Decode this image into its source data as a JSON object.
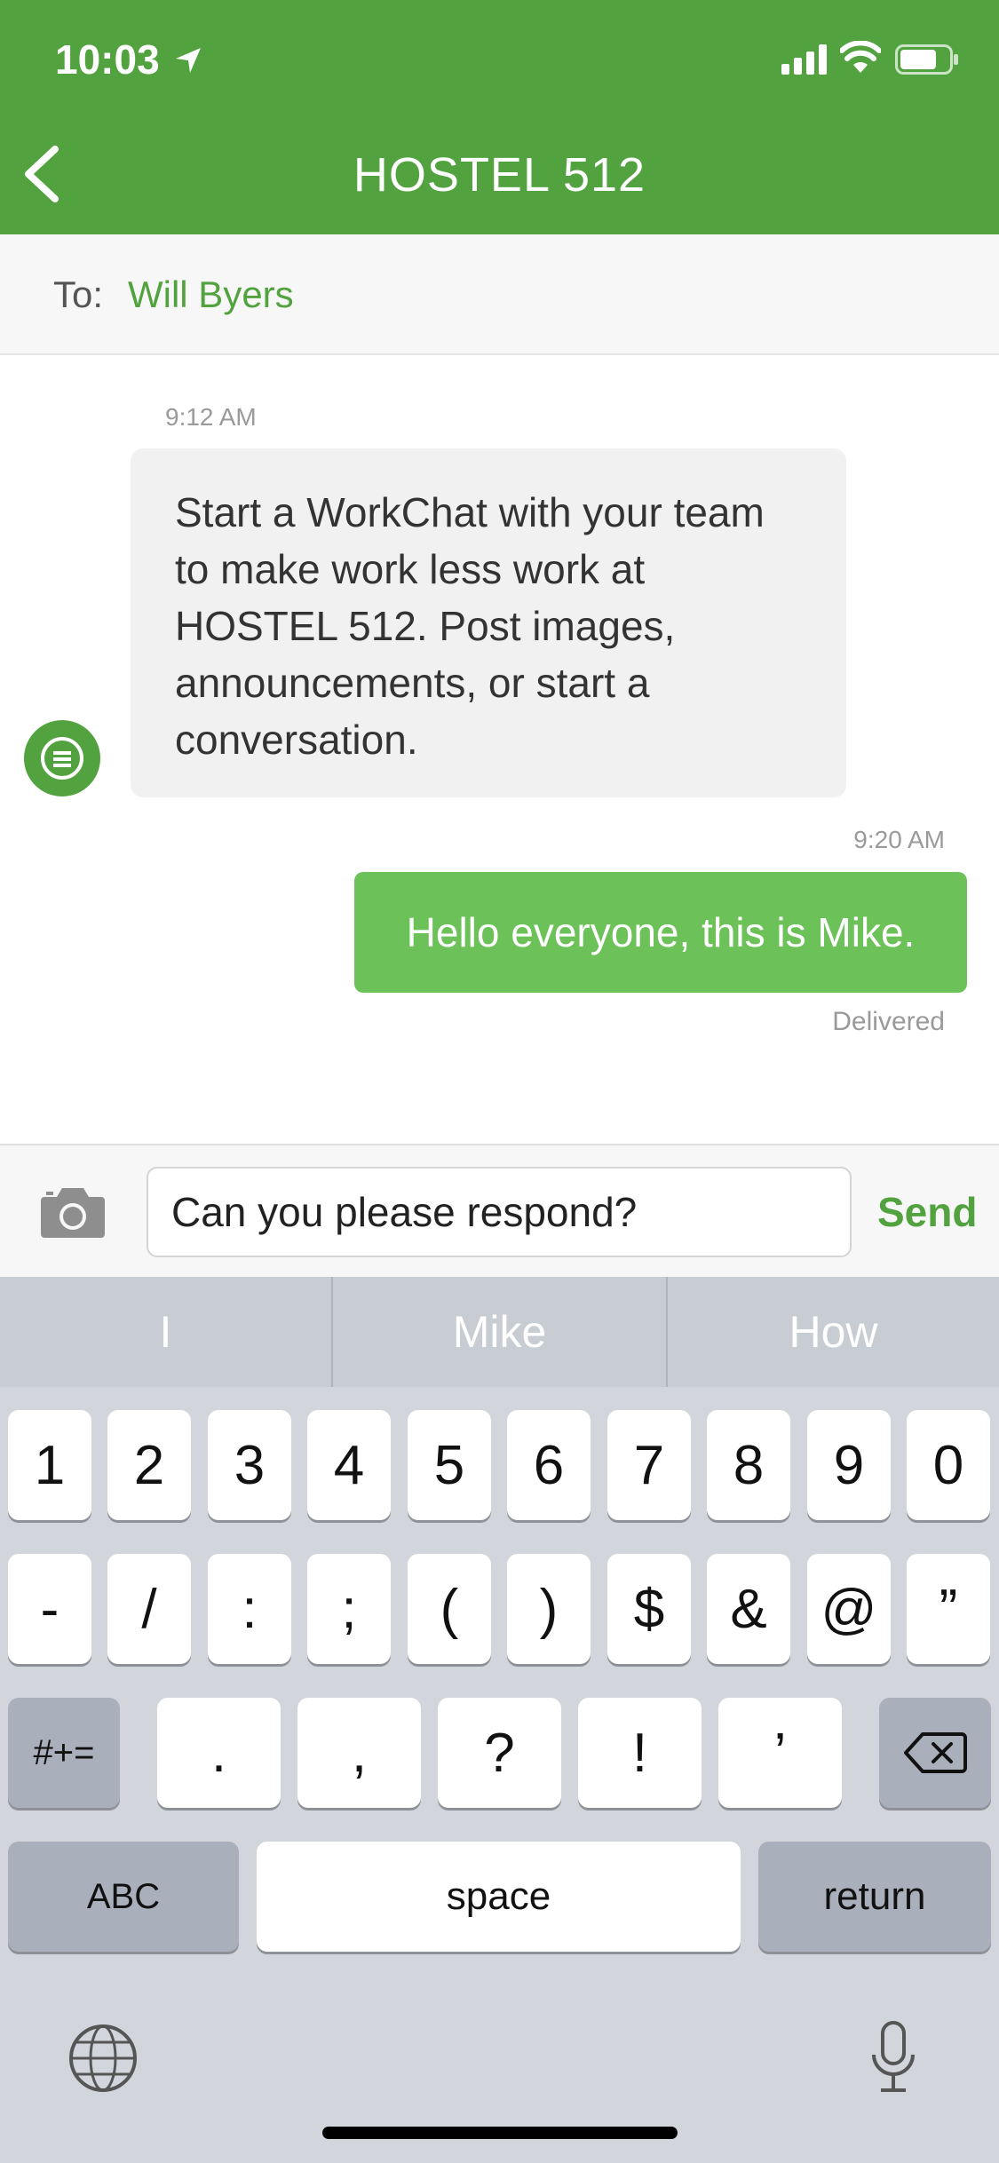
{
  "status_bar": {
    "time": "10:03",
    "icons": [
      "location-arrow-icon",
      "cellular-signal-icon",
      "wifi-icon",
      "battery-icon"
    ]
  },
  "header": {
    "title": "HOSTEL 512",
    "back_icon": "chevron-left-icon",
    "background": "#52a33f"
  },
  "recipient": {
    "label": "To:",
    "name": "Will Byers"
  },
  "messages": [
    {
      "timestamp": "9:12 AM",
      "direction": "incoming",
      "avatar_icon": "list-circle-icon",
      "text": "Start a WorkChat with your team to make work less work at HOSTEL 512. Post images, announcements, or start a conversation."
    },
    {
      "timestamp": "9:20 AM",
      "direction": "outgoing",
      "text": "Hello everyone, this is Mike.",
      "status": "Delivered"
    }
  ],
  "composer": {
    "camera_icon": "camera-icon",
    "input_value": "Can you please respond?",
    "send_label": "Send"
  },
  "keyboard": {
    "suggestions": [
      "I",
      "Mike",
      "How"
    ],
    "row1": [
      "1",
      "2",
      "3",
      "4",
      "5",
      "6",
      "7",
      "8",
      "9",
      "0"
    ],
    "row2": [
      "-",
      "/",
      ":",
      ";",
      "(",
      ")",
      "$",
      "&",
      "@",
      "”"
    ],
    "row3": [
      "#+=",
      ".",
      ",",
      "?",
      "!",
      "’"
    ],
    "backspace_icon": "backspace-icon",
    "row4": [
      "ABC",
      "space",
      "return"
    ],
    "globe_icon": "globe-icon",
    "mic_icon": "microphone-icon"
  },
  "colors": {
    "accent": "#52a33f",
    "outgoing_bubble": "#6cc259",
    "incoming_bubble": "#f1f1f1"
  }
}
